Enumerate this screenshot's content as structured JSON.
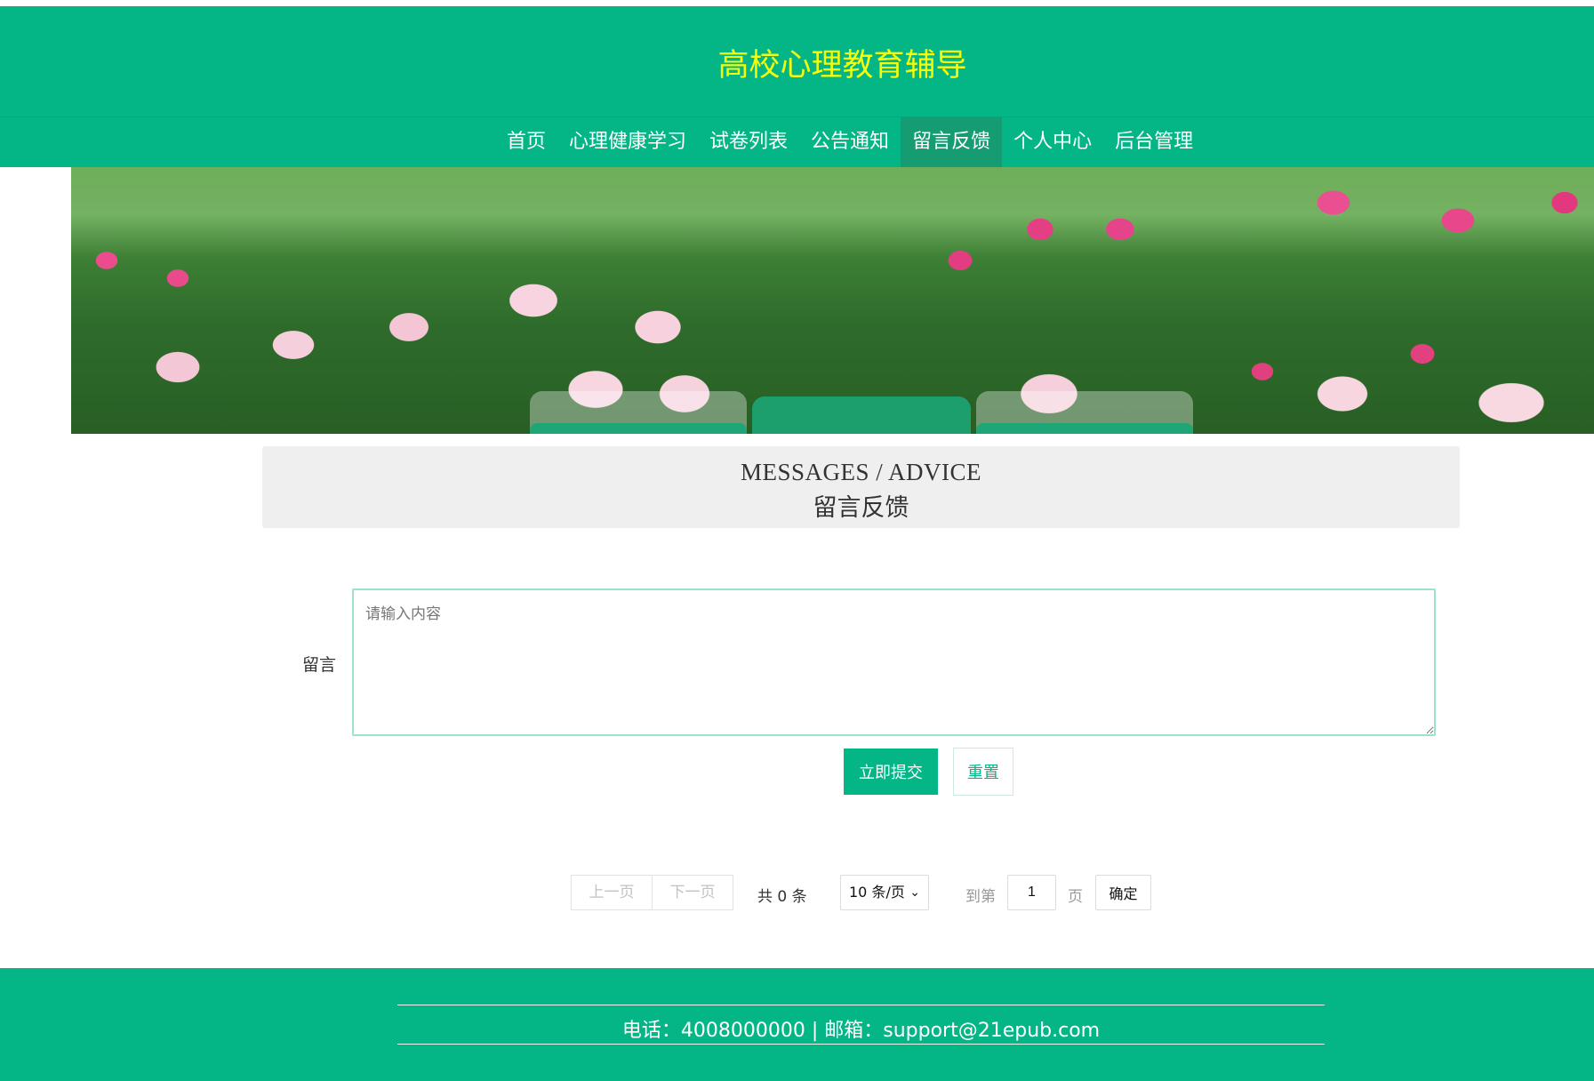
{
  "header": {
    "title": "高校心理教育辅导"
  },
  "nav": {
    "items": [
      {
        "label": "首页"
      },
      {
        "label": "心理健康学习"
      },
      {
        "label": "试卷列表"
      },
      {
        "label": "公告通知"
      },
      {
        "label": "留言反馈"
      },
      {
        "label": "个人中心"
      },
      {
        "label": "后台管理"
      }
    ],
    "active": "留言反馈"
  },
  "section": {
    "title_en": "MESSAGES / ADVICE",
    "title_cn": "留言反馈"
  },
  "form": {
    "message_label": "留言",
    "message_placeholder": "请输入内容",
    "message_value": "",
    "submit_label": "立即提交",
    "reset_label": "重置"
  },
  "pagination": {
    "prev_label": "上一页",
    "next_label": "下一页",
    "total_text": "共 0 条",
    "page_size_selected": "10 条/页",
    "goto_label": "到第",
    "current_page": "1",
    "page_suffix": "页",
    "confirm_label": "确定"
  },
  "footer": {
    "contact": "电话：4008000000 | 邮箱：support@21epub.com"
  },
  "colors": {
    "primary": "#04b586",
    "title_yellow": "#f4ff0c",
    "nav_active": "#159c72"
  }
}
